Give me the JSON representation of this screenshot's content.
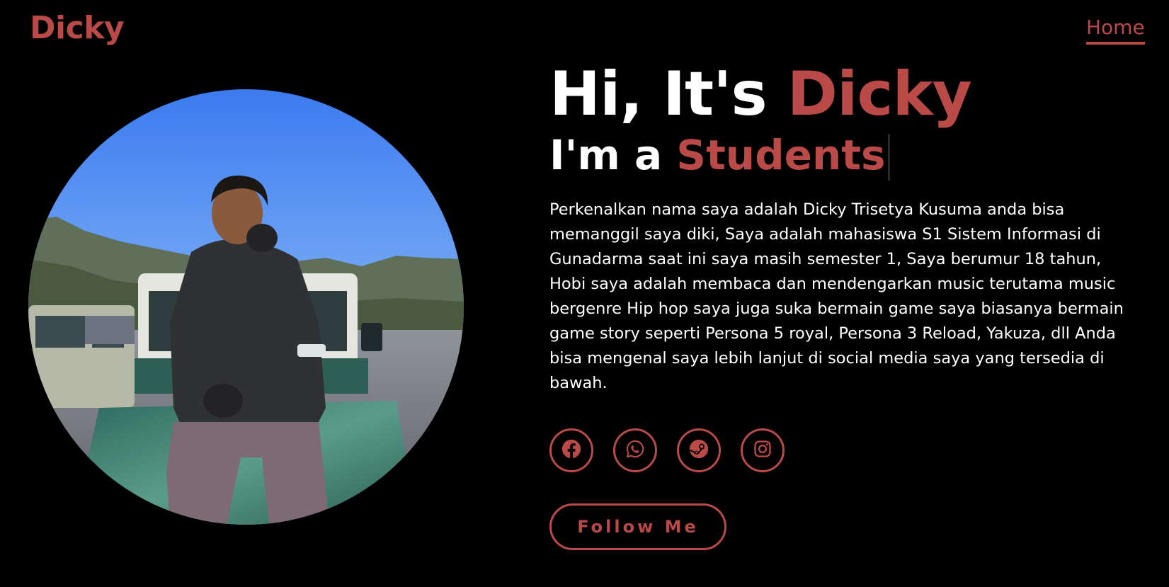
{
  "header": {
    "logo": "Dicky",
    "nav": {
      "home_label": "Home"
    }
  },
  "profile_photo": {
    "alt": "Dicky"
  },
  "hero": {
    "title_prefix": "Hi, It's ",
    "title_name": "Dicky",
    "subtitle_prefix": "I'm a ",
    "subtitle_role": "Students",
    "bio": "Perkenalkan nama saya adalah Dicky Trisetya Kusuma anda bisa memanggil saya diki, Saya adalah mahasiswa S1 Sistem Informasi di Gunadarma saat ini saya masih semester 1, Saya berumur 18 tahun, Hobi saya adalah membaca dan mendengarkan music terutama music bergenre Hip hop saya juga suka bermain game saya biasanya bermain game story seperti Persona 5 royal, Persona 3 Reload, Yakuza, dll Anda bisa mengenal saya lebih lanjut di social media saya yang tersedia di bawah."
  },
  "socials": [
    {
      "icon": "facebook-icon"
    },
    {
      "icon": "whatsapp-icon"
    },
    {
      "icon": "steam-icon"
    },
    {
      "icon": "instagram-icon"
    }
  ],
  "cta": {
    "follow_label": "Follow Me"
  },
  "colors": {
    "background": "#000000",
    "accent": "#b94a48",
    "text": "#ffffff"
  }
}
